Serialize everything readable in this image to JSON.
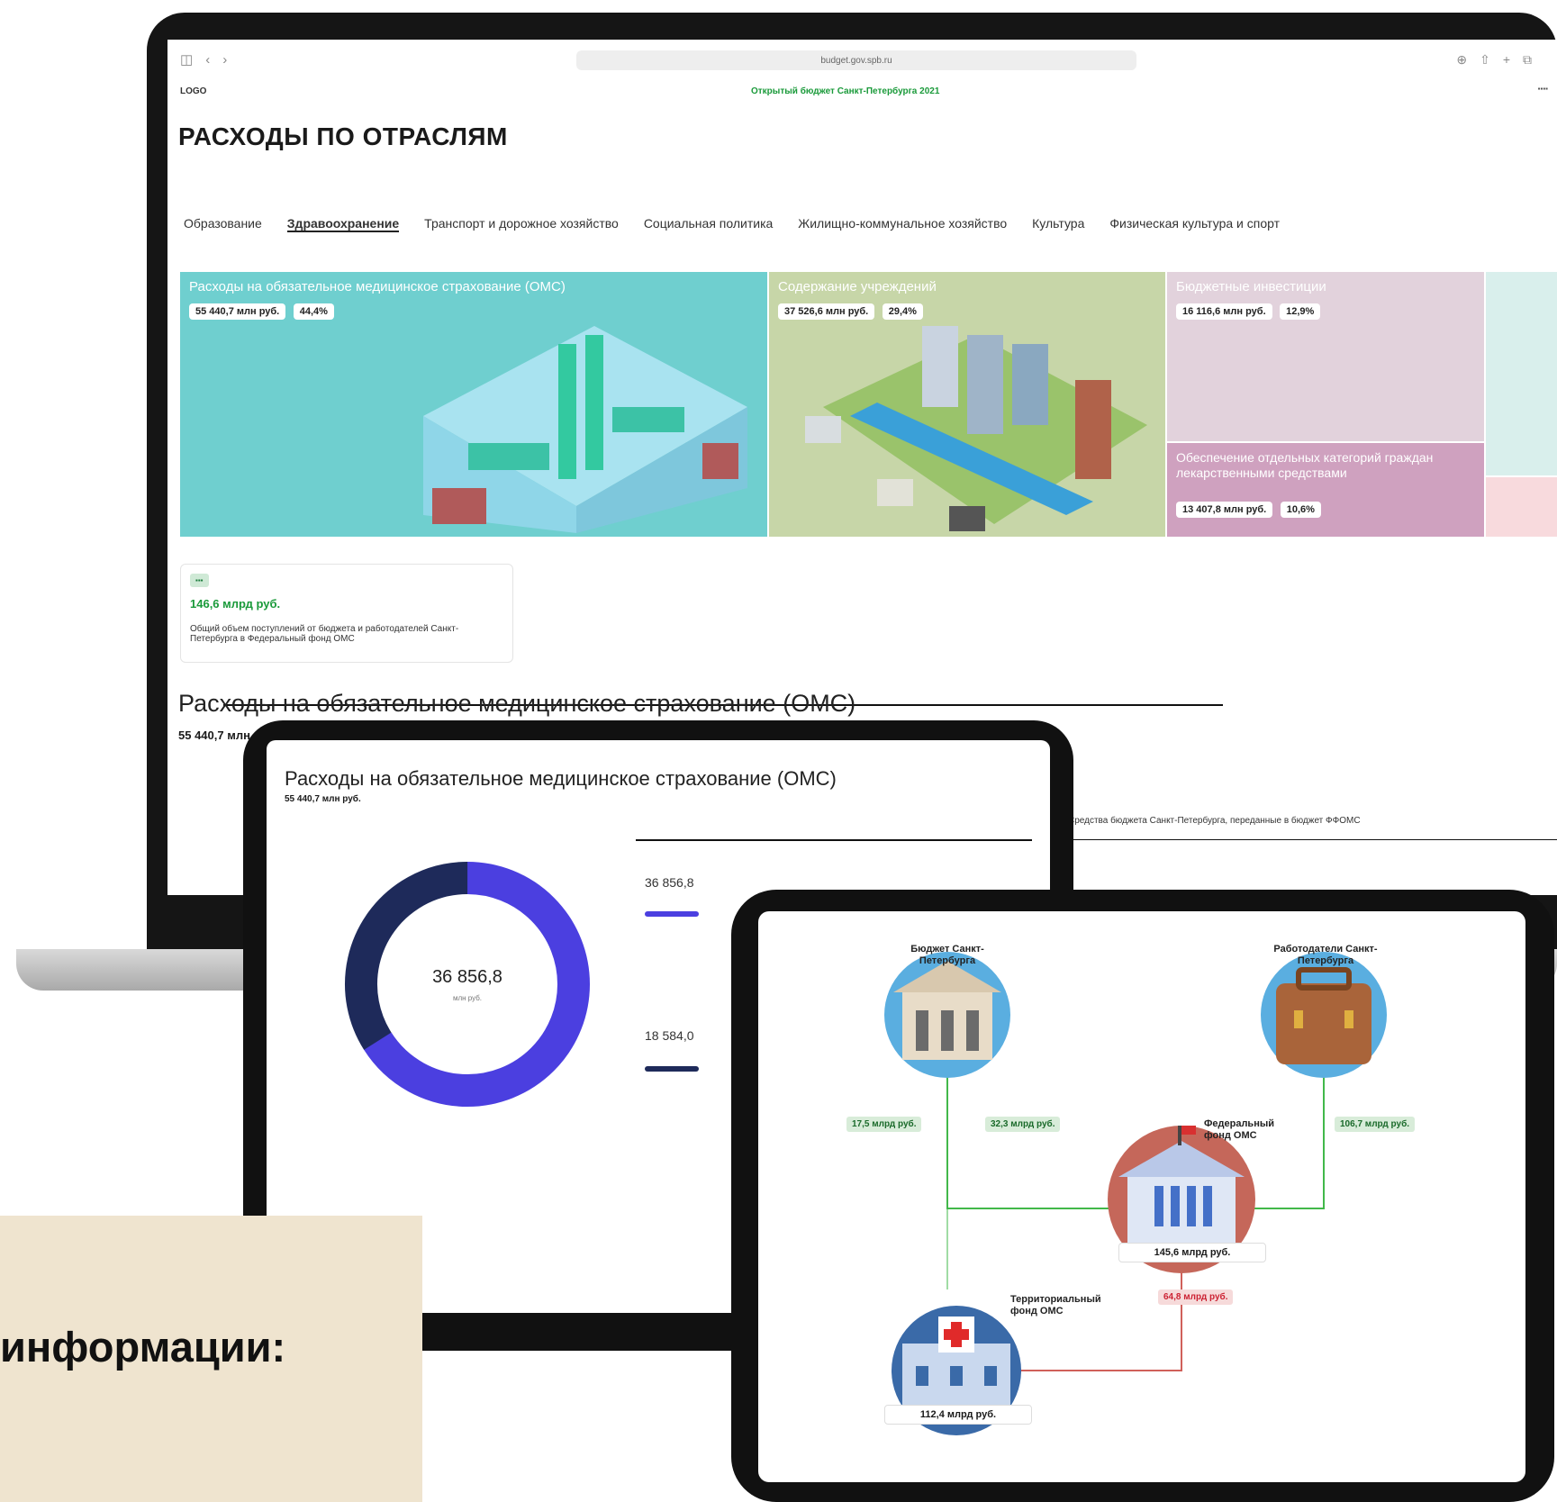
{
  "laptop": {
    "url": "budget.gov.spb.ru",
    "logo": "LOGO",
    "region": "Открытый бюджет Санкт-Петербурга 2021",
    "page_title": "РАСХОДЫ ПО ОТРАСЛЯМ",
    "tabs": [
      "Образование",
      "Здравоохранение",
      "Транспорт и дорожное хозяйство",
      "Социальная политика",
      "Жилищно-коммунальное хозяйство",
      "Культура",
      "Физическая культура и спорт"
    ],
    "cards": [
      {
        "title": "Расходы на обязательное медицинское страхование (ОМС)",
        "amount": "55 440,7 млн руб.",
        "share": "44,4%",
        "color": "#6fcfcf"
      },
      {
        "title": "Содержание учреждений",
        "amount": "37 526,6 млн руб.",
        "share": "29,4%",
        "color": "#c7d6a8"
      },
      {
        "title": "Бюджетные инвестиции",
        "amount": "16 116,6 млн руб.",
        "share": "12,9%",
        "color": "#e2d2dc"
      },
      {
        "title": "Обеспечение отдельных категорий граждан лекарственными средствами",
        "amount": "13 407,8 млн руб.",
        "share": "10,6%",
        "color": "#cfa1bf"
      }
    ],
    "info": {
      "value": "146,6 млрд руб.",
      "description": "Общий объем поступлений от бюджета и работодателей Санкт-Петербурга в Федеральный фонд ОМС"
    },
    "section_title": "Расходы на обязательное медицинское страхование (ОМС)",
    "section_sub": "55 440,7 млн руб.",
    "right_text": "Средства бюджета Санкт-Петербурга, переданные в бюджет ФФОМС",
    "progress": 0.48
  },
  "tablet1": {
    "title": "Расходы на обязательное медицинское страхование (ОМС)",
    "sub": "55 440,7 млн руб.",
    "donut_value": "36 856,8",
    "donut_unit": "млн руб.",
    "right_value": "36 856,8",
    "right_value2": "18 584,0",
    "donut_segments": [
      0.66,
      0.34
    ],
    "colors": {
      "a": "#4b3fe0",
      "b": "#1e2a5a"
    }
  },
  "tablet2": {
    "budget_label": "Бюджет Санкт-Петербурга",
    "employers_label": "Работодатели Санкт-Петербурга",
    "fed_fund_label": "Федеральный фонд ОМС",
    "terr_fund_label": "Территориальный фонд ОМС",
    "badge1": "17,5 млрд руб.",
    "badge2": "32,3 млрд руб.",
    "badge3": "106,7 млрд руб.",
    "badge4": "64,8 млрд руб.",
    "fed_total": "145,6 млрд руб.",
    "terr_total": "112,4 млрд руб."
  },
  "caption": {
    "text": "информации:"
  }
}
